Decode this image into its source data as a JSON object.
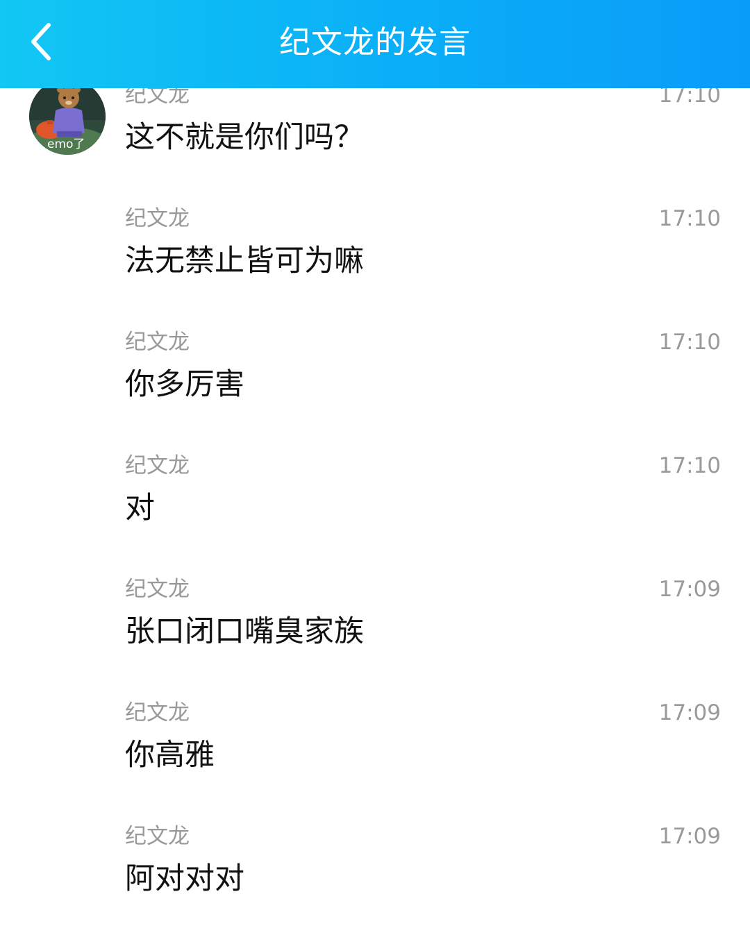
{
  "header": {
    "title": "纪文龙的发言",
    "back_icon": "chevron-left-icon"
  },
  "avatar": {
    "overlay_text": "emo了"
  },
  "messages": [
    {
      "sender": "纪文龙",
      "time": "17:10",
      "text": "这不就是你们吗？"
    },
    {
      "sender": "纪文龙",
      "time": "17:10",
      "text": "法无禁止皆可为嘛"
    },
    {
      "sender": "纪文龙",
      "time": "17:10",
      "text": "你多厉害"
    },
    {
      "sender": "纪文龙",
      "time": "17:10",
      "text": "对"
    },
    {
      "sender": "纪文龙",
      "time": "17:09",
      "text": "张口闭口嘴臭家族"
    },
    {
      "sender": "纪文龙",
      "time": "17:09",
      "text": "你高雅"
    },
    {
      "sender": "纪文龙",
      "time": "17:09",
      "text": "阿对对对"
    }
  ],
  "colors": {
    "header_start": "#12c7f4",
    "header_end": "#0a9cf9",
    "meta_text": "#999999",
    "message_text": "#111111"
  }
}
